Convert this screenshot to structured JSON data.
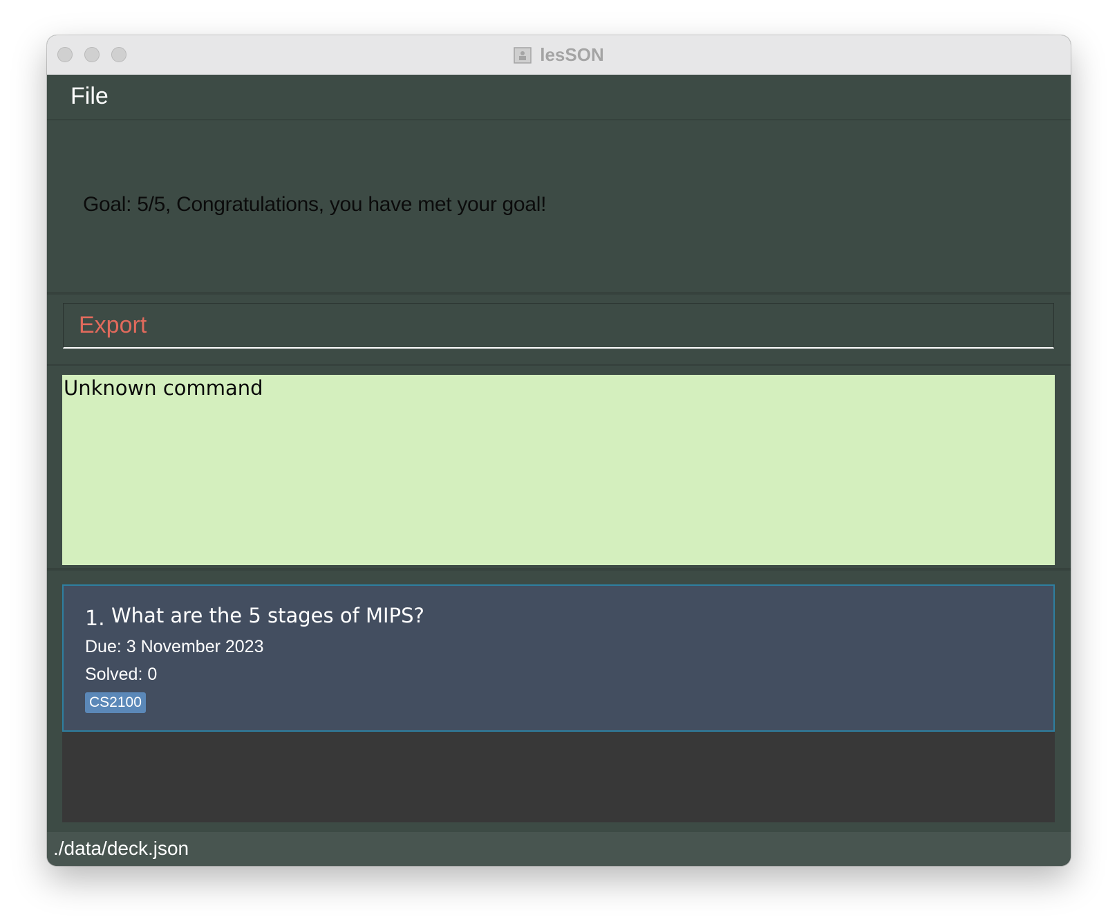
{
  "window": {
    "title": "lesSON",
    "app_icon": "app-document-icon"
  },
  "menubar": {
    "items": [
      "File"
    ]
  },
  "goal": {
    "text": "Goal: 5/5, Congratulations, you have met your goal!"
  },
  "command": {
    "value": "Export"
  },
  "result": {
    "text": "Unknown command"
  },
  "cards": [
    {
      "index": "1.",
      "question": "What are the 5 stages of MIPS?",
      "due": "Due: 3 November 2023",
      "solved": "Solved: 0",
      "tag": "CS2100"
    }
  ],
  "status": {
    "path": "./data/deck.json"
  },
  "colors": {
    "window_bg": "#3d4b45",
    "command_text": "#e16a5c",
    "result_bg": "#d4efbe",
    "card_bg": "#434e60",
    "card_border": "#2e7fa0",
    "tag_bg": "#5b88b8",
    "list_bg": "#383838",
    "statusbar_bg": "#485550"
  }
}
